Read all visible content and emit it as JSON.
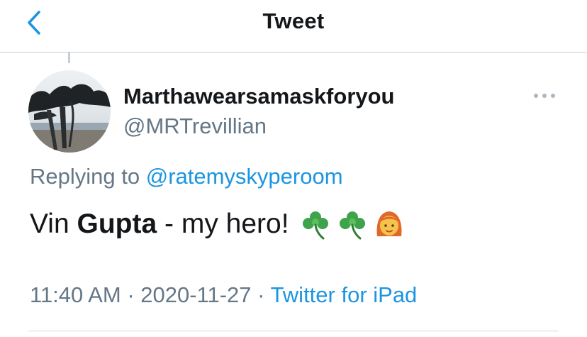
{
  "header": {
    "title": "Tweet",
    "back_icon": "chevron-left-icon"
  },
  "colors": {
    "accent": "#1b95e0",
    "text_primary": "#14171a",
    "text_secondary": "#657786",
    "divider": "#c8cdd2"
  },
  "tweet": {
    "display_name": "Marthawearsamaskforyou",
    "handle": "@MRTrevillian",
    "more_icon": "more-horizontal-icon",
    "replying_prefix": "Replying to",
    "replying_to": "@ratemyskyperoom",
    "text_before": "Vin",
    "text_bold": "Gupta",
    "text_after": "- my hero!",
    "emojis": [
      "shamrock-emoji",
      "shamrock-emoji",
      "woman-red-hair-emoji"
    ],
    "time": "11:40 AM",
    "separator": "·",
    "date": "2020-11-27",
    "source": "Twitter for iPad"
  }
}
